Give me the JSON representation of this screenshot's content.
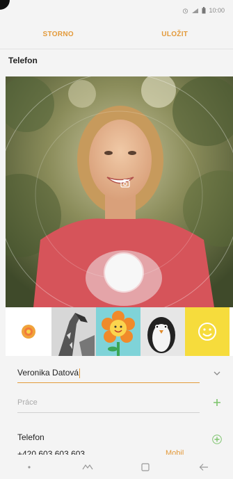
{
  "status_bar": {
    "time": "10:00",
    "icons": [
      "alarm-icon",
      "signal-icon",
      "battery-icon"
    ]
  },
  "action_bar": {
    "cancel_label": "STORNO",
    "save_label": "ULOŽIT"
  },
  "section": {
    "title": "Telefon"
  },
  "camera": {
    "icons": [
      "switch-camera-icon"
    ],
    "shutter": "shutter-button"
  },
  "stickers": {
    "items": [
      "sticker-category-icon",
      "giraffe",
      "flower-face",
      "penguin",
      "smiley"
    ]
  },
  "form": {
    "name_value": "Veronika Datová",
    "work_placeholder": "Práce",
    "phone_label": "Telefon",
    "phone_number": "+420 603 603 603",
    "phone_type": "Mobil"
  },
  "nav_bar": {
    "icons": [
      "dot-icon",
      "recent-apps-icon",
      "home-icon",
      "back-icon"
    ]
  },
  "colors": {
    "accent": "#e39a3a",
    "add_green": "#7cc36b"
  }
}
